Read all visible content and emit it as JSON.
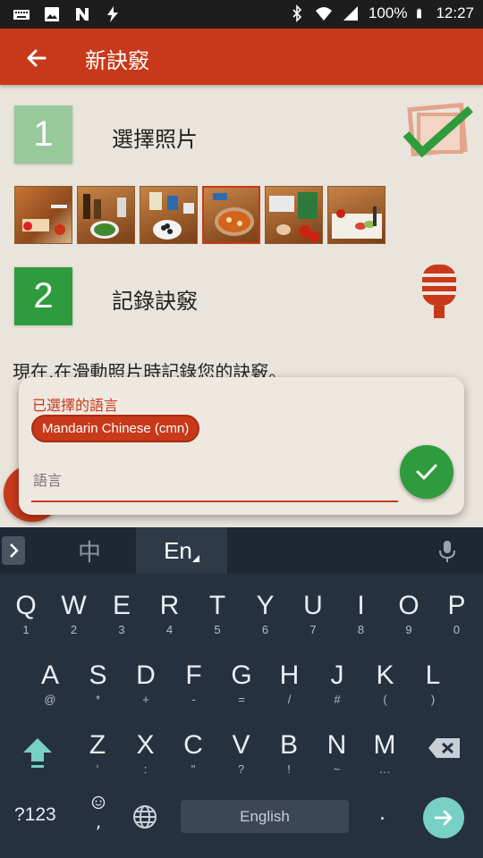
{
  "status_bar": {
    "battery": "100%",
    "time": "12:27"
  },
  "app_bar": {
    "title": "新訣竅"
  },
  "steps": [
    {
      "number": "1",
      "label": "選擇照片"
    },
    {
      "number": "2",
      "label": "記錄訣竅"
    }
  ],
  "instruction": "現在,在滑動照片時記錄您的訣竅。",
  "dialog": {
    "selected_label": "已選擇的語言",
    "chip": "Mandarin Chinese (cmn)",
    "input_placeholder": "語言"
  },
  "keyboard": {
    "lang_zh": "中",
    "lang_en": "En",
    "row1": [
      {
        "k": "Q",
        "s": "1"
      },
      {
        "k": "W",
        "s": "2"
      },
      {
        "k": "E",
        "s": "3"
      },
      {
        "k": "R",
        "s": "4"
      },
      {
        "k": "T",
        "s": "5"
      },
      {
        "k": "Y",
        "s": "6"
      },
      {
        "k": "U",
        "s": "7"
      },
      {
        "k": "I",
        "s": "8"
      },
      {
        "k": "O",
        "s": "9"
      },
      {
        "k": "P",
        "s": "0"
      }
    ],
    "row2": [
      {
        "k": "A",
        "s": "@"
      },
      {
        "k": "S",
        "s": "*"
      },
      {
        "k": "D",
        "s": "+"
      },
      {
        "k": "F",
        "s": "-"
      },
      {
        "k": "G",
        "s": "="
      },
      {
        "k": "H",
        "s": "/"
      },
      {
        "k": "J",
        "s": "#"
      },
      {
        "k": "K",
        "s": "("
      },
      {
        "k": "L",
        "s": ")"
      }
    ],
    "row3": [
      {
        "k": "Z",
        "s": "'"
      },
      {
        "k": "X",
        "s": ":"
      },
      {
        "k": "C",
        "s": "\""
      },
      {
        "k": "V",
        "s": "?"
      },
      {
        "k": "B",
        "s": "!"
      },
      {
        "k": "N",
        "s": "~"
      },
      {
        "k": "M",
        "s": "…"
      }
    ],
    "symbols_label": "?123",
    "emoji_sub": ",",
    "space_label": "English",
    "period_label": "."
  },
  "colors": {
    "accent": "#c8391a",
    "green": "#2e9c3c",
    "light_green": "#98c99a",
    "keyboard_bg": "#263140"
  }
}
